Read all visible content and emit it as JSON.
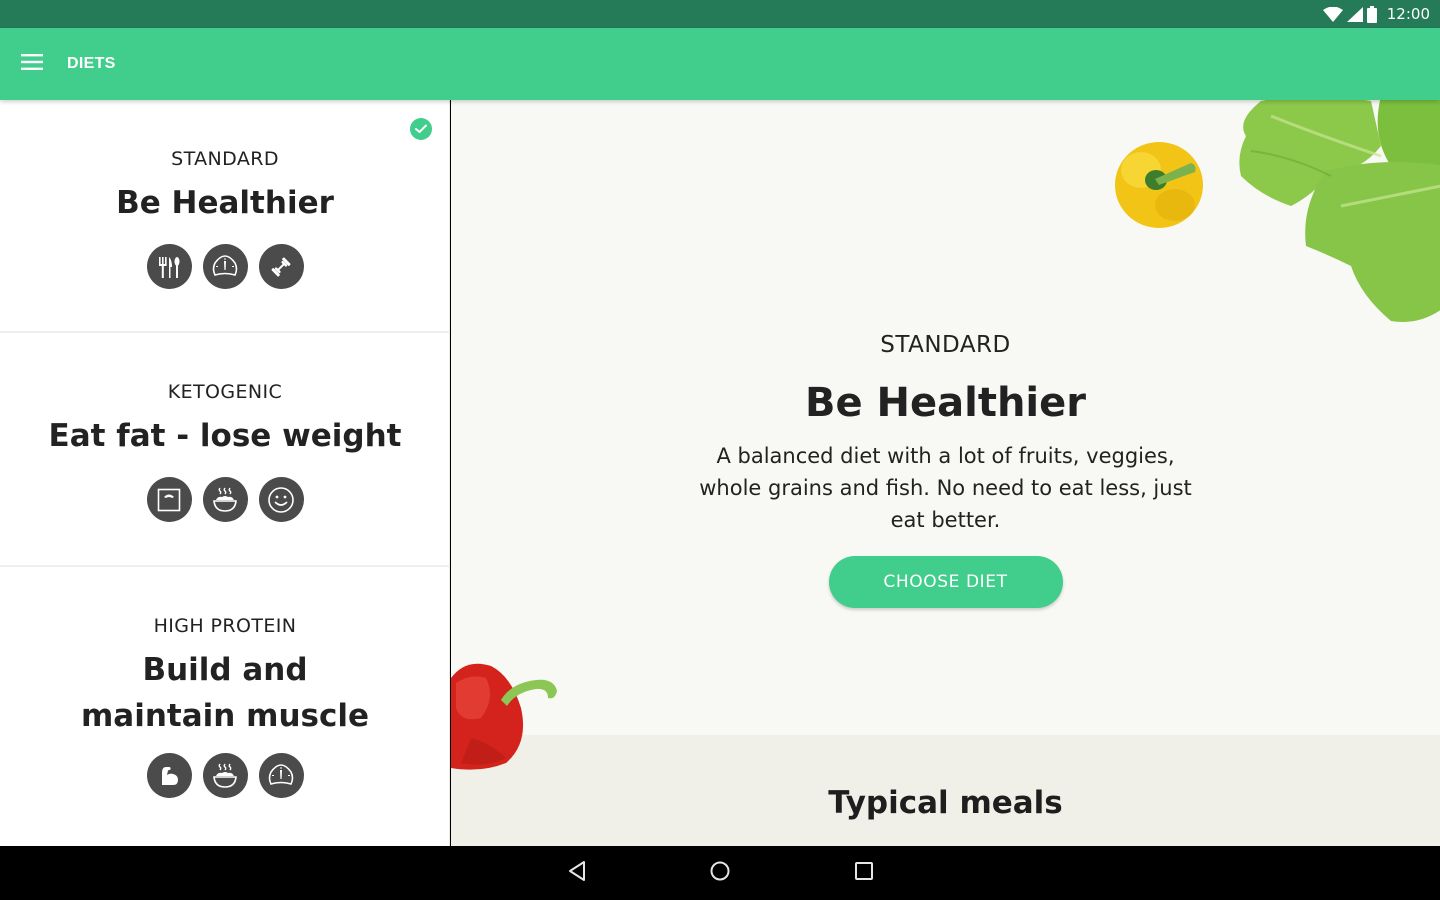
{
  "status_bar": {
    "time": "12:00",
    "icons": [
      "wifi-icon",
      "cell-signal-icon",
      "battery-icon"
    ]
  },
  "app_bar": {
    "menu_icon": "hamburger-menu-icon",
    "title": "DIETS",
    "color": "#41cd8c"
  },
  "diets": [
    {
      "type": "STANDARD",
      "name": "Be Healthier",
      "selected": true,
      "icons": [
        "cutlery-icon",
        "speedometer-icon",
        "dumbbell-icon"
      ]
    },
    {
      "type": "KETOGENIC",
      "name": "Eat fat - lose weight",
      "selected": false,
      "icons": [
        "scale-icon",
        "hot-bowl-icon",
        "smiley-icon"
      ]
    },
    {
      "type": "HIGH PROTEIN",
      "name": "Build and maintain muscle",
      "selected": false,
      "icons": [
        "flexed-arm-icon",
        "hot-bowl-icon",
        "speedometer-icon"
      ]
    }
  ],
  "detail": {
    "type": "STANDARD",
    "name": "Be Healthier",
    "description": "A balanced diet with a lot of fruits, veggies, whole grains and fish. No need to eat less, just eat better.",
    "cta_label": "CHOOSE DIET",
    "decorations": [
      "yellow-pepper",
      "lettuce",
      "red-pepper"
    ]
  },
  "meals_section": {
    "title": "Typical meals"
  },
  "nav_bar": {
    "buttons": [
      "back-icon",
      "home-icon",
      "recents-icon"
    ]
  }
}
